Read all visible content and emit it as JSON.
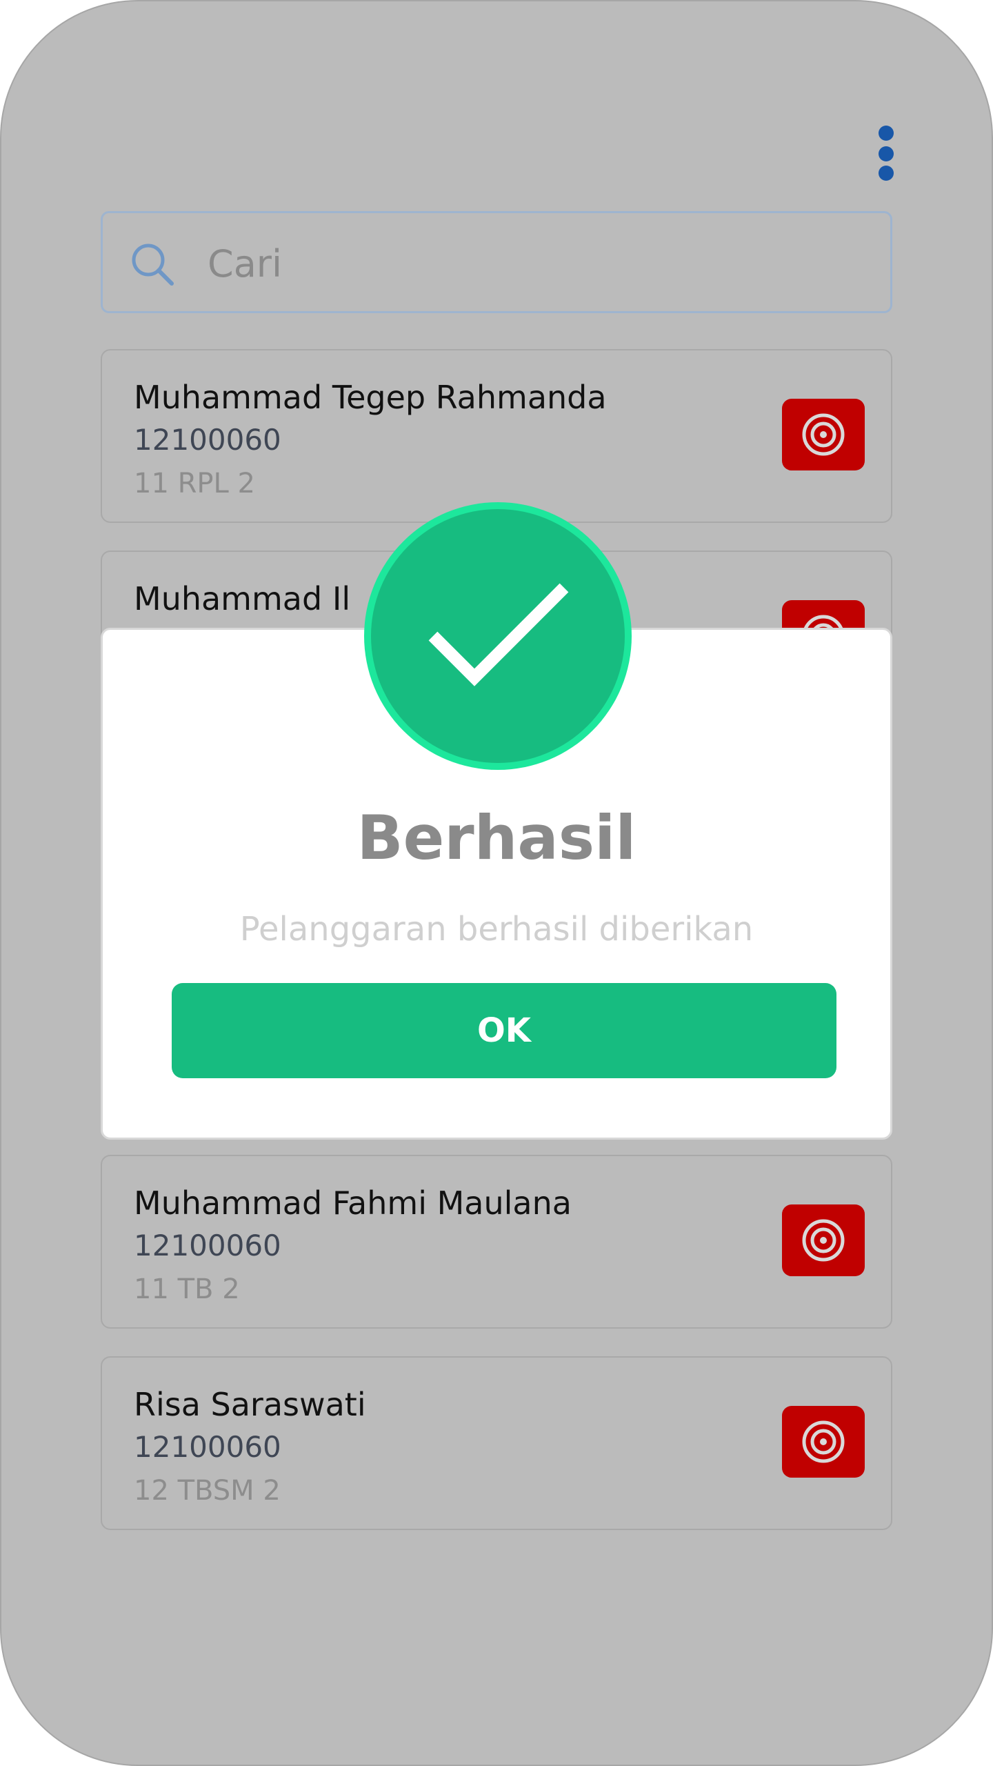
{
  "search": {
    "placeholder": "Cari"
  },
  "students": [
    {
      "name": "Muhammad Tegep Rahmanda",
      "nis": "12100060",
      "kelas": "11 RPL 2"
    },
    {
      "name": "Muhammad Il",
      "nis": "",
      "kelas": ""
    },
    {
      "name": "Muhammad Fahmi Maulana",
      "nis": "12100060",
      "kelas": "11 TB 2"
    },
    {
      "name": "Risa Saraswati",
      "nis": "12100060",
      "kelas": "12 TBSM 2"
    }
  ],
  "dialog": {
    "title": "Berhasil",
    "message": "Pelanggaran berhasil diberikan",
    "ok_label": "OK"
  },
  "colors": {
    "accent_green": "#17bc80",
    "badge_ring": "#1de79c",
    "action_red": "#c00000",
    "menu_blue": "#1857a8",
    "overlay_gray": "#bbbbbb"
  },
  "icons": {
    "menu": "more-vertical-icon",
    "search": "search-icon",
    "action": "target-icon",
    "success": "check-icon"
  }
}
